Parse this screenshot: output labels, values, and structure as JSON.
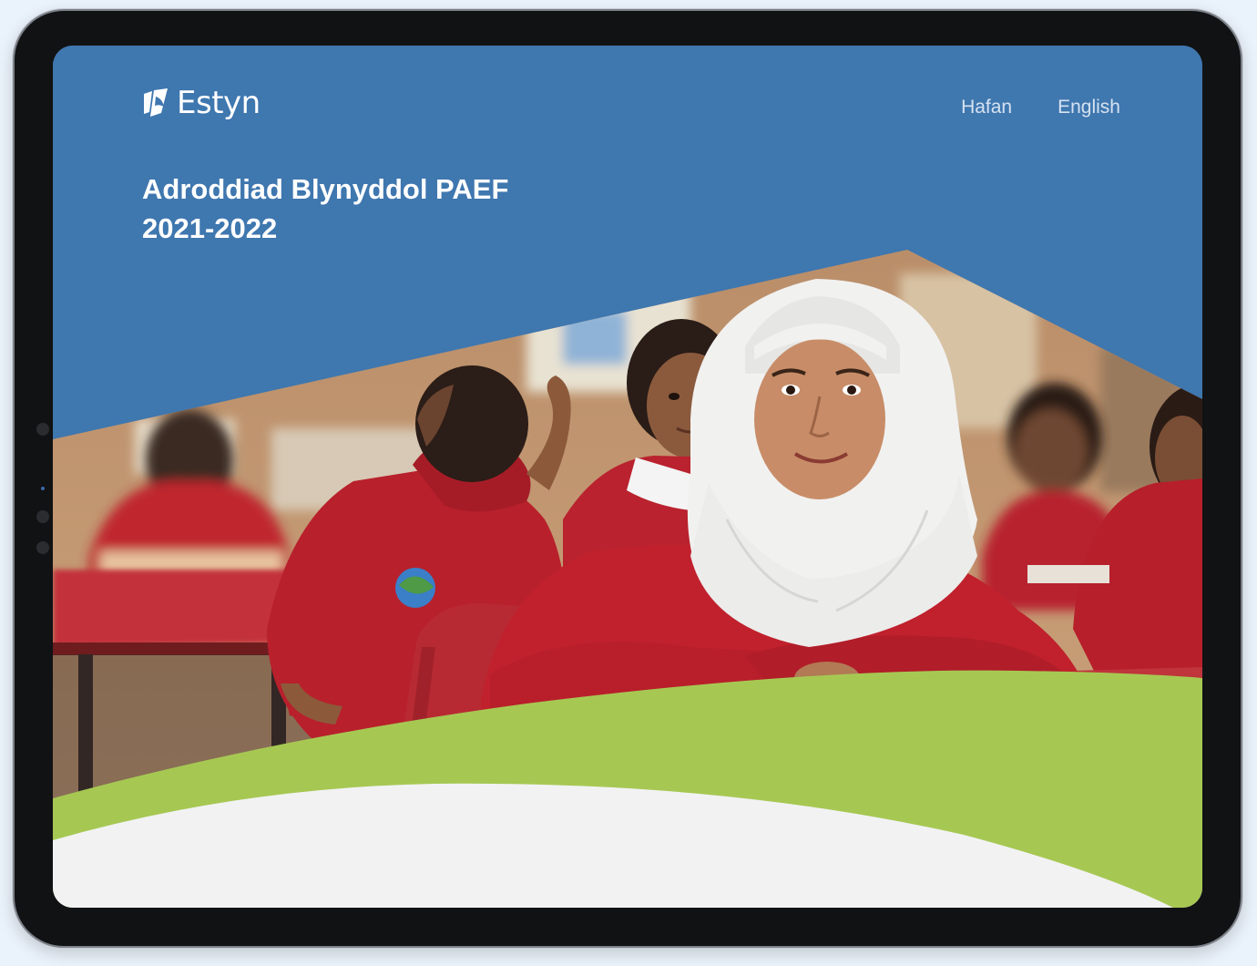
{
  "brand": {
    "name": "Estyn",
    "logo_icon": "estyn-logo-mark"
  },
  "nav": {
    "items": [
      {
        "label": "Hafan"
      },
      {
        "label": "English"
      }
    ]
  },
  "hero": {
    "title_line1": "Adroddiad Blynyddol PAEF",
    "title_line2": "2021-2022",
    "photo_icon": "classroom-photo"
  },
  "colors": {
    "blue": "#3f77af",
    "green": "#a6c853",
    "light": "#f2f2f3",
    "uniform_red": "#c2242f"
  }
}
